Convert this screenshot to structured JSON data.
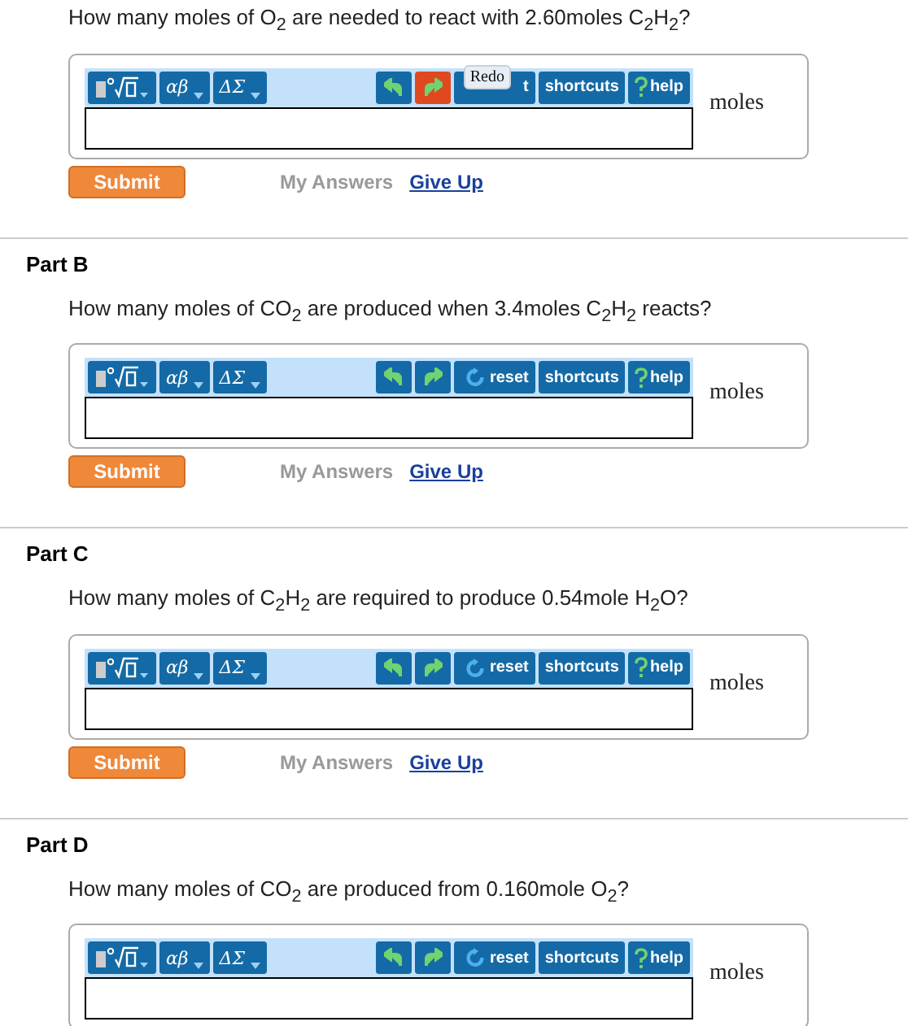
{
  "parts": [
    {
      "question": "How many moles of O$_{2}$ are needed to react with 2.60moles C$_{2}$H$_{2}$?",
      "toolbar": {
        "symbol_buttons": [
          "αβ",
          "ΔΣ"
        ],
        "redo_hovered": true,
        "reset_label": "t",
        "reset_icon_visible": false,
        "tooltip": "Redo",
        "shortcuts": "shortcuts",
        "help": "help"
      },
      "unit": "moles",
      "actions": {
        "submit": "Submit",
        "my_answers": "My Answers",
        "give_up": "Give Up"
      }
    },
    {
      "heading": "Part B",
      "question": "How many moles of CO$_{2}$ are produced when 3.4moles C$_{2}$H$_{2}$ reacts?",
      "toolbar": {
        "symbol_buttons": [
          "αβ",
          "ΔΣ"
        ],
        "redo_hovered": false,
        "reset_label": "reset",
        "reset_icon_visible": true,
        "shortcuts": "shortcuts",
        "help": "help"
      },
      "unit": "moles",
      "actions": {
        "submit": "Submit",
        "my_answers": "My Answers",
        "give_up": "Give Up"
      }
    },
    {
      "heading": "Part C",
      "question": "How many moles of C$_{2}$H$_{2}$ are required to produce 0.54mole H$_{2}$O?",
      "toolbar": {
        "symbol_buttons": [
          "αβ",
          "ΔΣ"
        ],
        "redo_hovered": false,
        "reset_label": "reset",
        "reset_icon_visible": true,
        "shortcuts": "shortcuts",
        "help": "help"
      },
      "unit": "moles",
      "actions": {
        "submit": "Submit",
        "my_answers": "My Answers",
        "give_up": "Give Up"
      }
    },
    {
      "heading": "Part D",
      "question": "How many moles of CO$_{2}$ are produced from 0.160mole O$_{2}$?",
      "toolbar": {
        "symbol_buttons": [
          "αβ",
          "ΔΣ"
        ],
        "redo_hovered": false,
        "reset_label": "reset",
        "reset_icon_visible": true,
        "shortcuts": "shortcuts",
        "help": "help"
      },
      "unit": "moles"
    }
  ]
}
